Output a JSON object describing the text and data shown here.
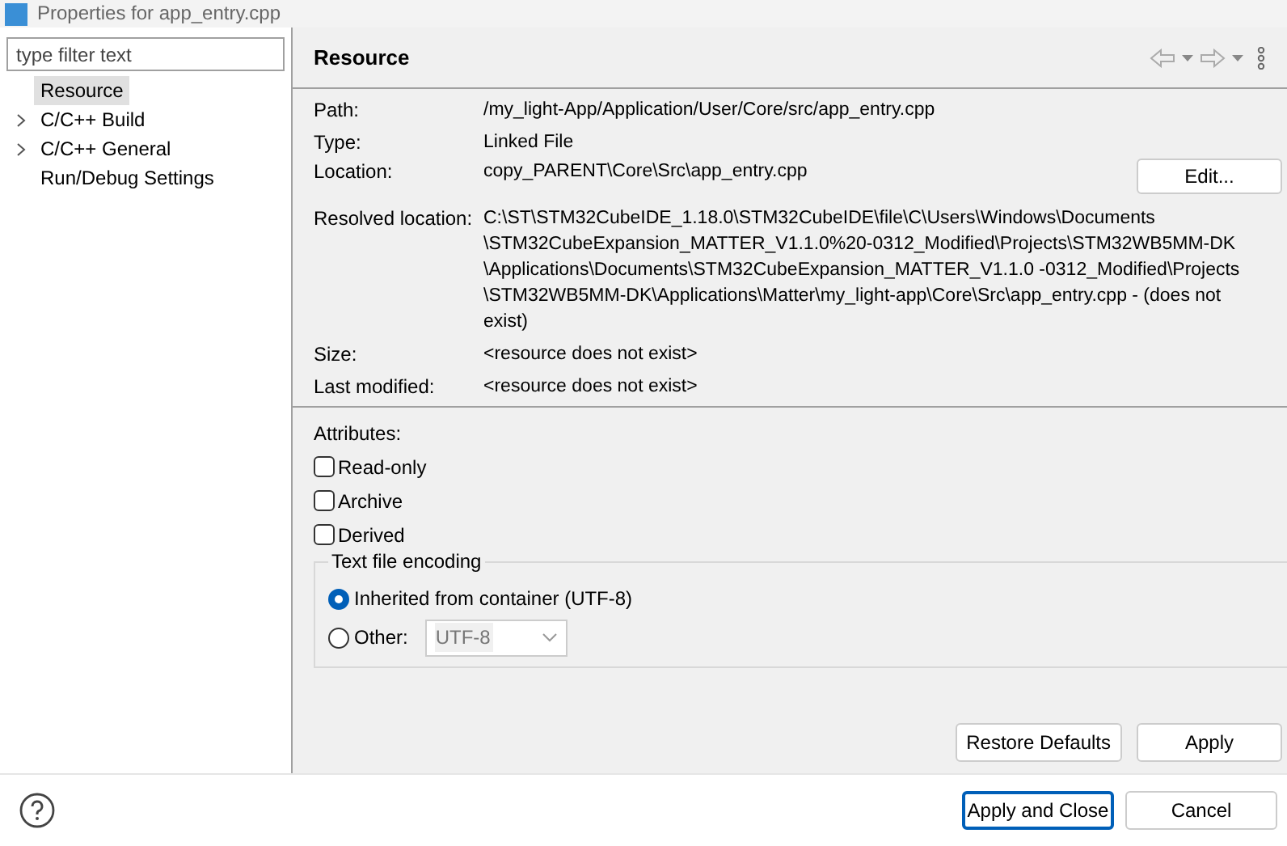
{
  "window": {
    "title": "Properties for app_entry.cpp"
  },
  "filter": {
    "placeholder": "type filter text"
  },
  "sidebar": {
    "items": [
      {
        "label": "Resource",
        "selected": true,
        "expandable": false
      },
      {
        "label": "C/C++ Build",
        "selected": false,
        "expandable": true
      },
      {
        "label": "C/C++ General",
        "selected": false,
        "expandable": true
      },
      {
        "label": "Run/Debug Settings",
        "selected": false,
        "expandable": false
      }
    ]
  },
  "page": {
    "title": "Resource",
    "fields": [
      {
        "label": "Path:",
        "value": "/my_light-App/Application/User/Core/src/app_entry.cpp"
      },
      {
        "label": "Type:",
        "value": "Linked File"
      },
      {
        "label": "Location:",
        "value": "copy_PARENT\\Core\\Src\\app_entry.cpp",
        "button": "Edit..."
      },
      {
        "label": "Resolved location:",
        "value": "C:\\ST\\STM32CubeIDE_1.18.0\\STM32CubeIDE\\file\\C\\Users\\Windows\\Documents \\STM32CubeExpansion_MATTER_V1.1.0%20-0312_Modified\\Projects\\STM32WB5MM-DK \\Applications\\Documents\\STM32CubeExpansion_MATTER_V1.1.0 -0312_Modified\\Projects \\STM32WB5MM-DK\\Applications\\Matter\\my_light-app\\Core\\Src\\app_entry.cpp - (does not exist)"
      },
      {
        "label": "Size:",
        "value": "<resource does not exist>"
      },
      {
        "label": "Last modified:",
        "value": "<resource does not exist>"
      }
    ],
    "attributes_label": "Attributes:",
    "attributes": [
      {
        "label": "Read-only",
        "checked": false
      },
      {
        "label": "Archive",
        "checked": false
      },
      {
        "label": "Derived",
        "checked": false
      }
    ],
    "encoding": {
      "title": "Text file encoding",
      "options": [
        {
          "label": "Inherited from container (UTF-8)",
          "selected": true
        },
        {
          "label": "Other:",
          "selected": false
        }
      ],
      "other_value": "UTF-8"
    },
    "buttons": [
      "Restore Defaults",
      "Apply"
    ]
  },
  "footer": {
    "buttons": [
      "Apply and Close",
      "Cancel"
    ]
  }
}
